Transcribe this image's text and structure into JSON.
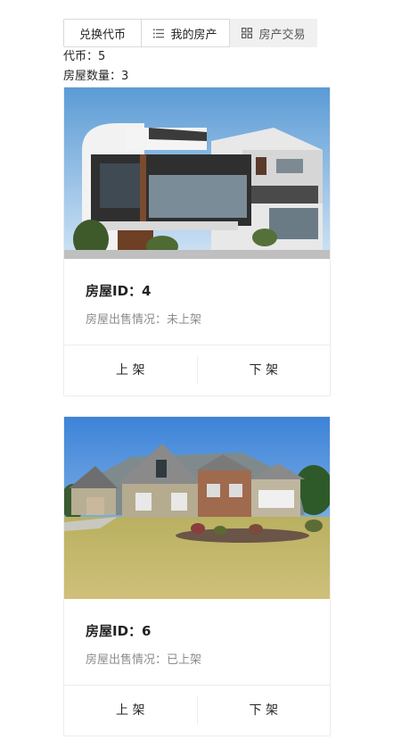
{
  "tabs": {
    "exchange": "兑换代币",
    "mine": "我的房产",
    "trade": "房产交易"
  },
  "summary": {
    "coins": "代币：5",
    "house_count": "房屋数量：3"
  },
  "cards": [
    {
      "id_text": "房屋ID：4",
      "status_text": "房屋出售情况：未上架",
      "list_label": "上 架",
      "unlist_label": "下 架"
    },
    {
      "id_text": "房屋ID：6",
      "status_text": "房屋出售情况：已上架",
      "list_label": "上 架",
      "unlist_label": "下 架"
    }
  ]
}
